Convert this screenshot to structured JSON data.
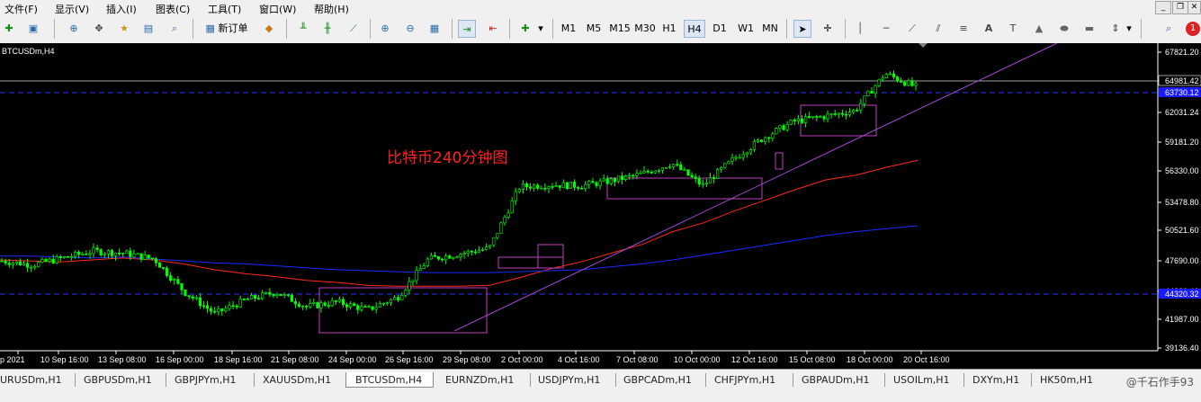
{
  "menu": {
    "items": [
      "文件(F)",
      "显示(V)",
      "插入(I)",
      "图表(C)",
      "工具(T)",
      "窗口(W)",
      "帮助(H)"
    ],
    "notification_count": "1"
  },
  "toolbar": {
    "new_order_label": "新订单",
    "timeframes": [
      "M1",
      "M5",
      "M15",
      "M30",
      "H1",
      "H4",
      "D1",
      "W1",
      "MN"
    ],
    "active_timeframe": "H4"
  },
  "chart": {
    "symbol_label": "BTCUSDm,H4",
    "annotation": "比特币240分钟图",
    "current_price_label": "64981.42",
    "blue_line_label_top": "63730.12",
    "blue_line_label_bottom": "44320.32",
    "price_ticks": [
      "67821.20",
      "64981.42",
      "62031.24",
      "59181.20",
      "56330.00",
      "53478.80",
      "50521.60",
      "47690.00",
      "44820.40",
      "41987.00",
      "39136.40"
    ],
    "time_ticks": [
      "p 2021",
      "10 Sep 16:00",
      "13 Sep 08:00",
      "16 Sep 00:00",
      "18 Sep 16:00",
      "21 Sep 08:00",
      "24 Sep 00:00",
      "26 Sep 16:00",
      "29 Sep 08:00",
      "2 Oct 00:00",
      "4 Oct 16:00",
      "7 Oct 08:00",
      "10 Oct 00:00",
      "12 Oct 16:00",
      "15 Oct 08:00",
      "18 Oct 00:00",
      "20 Oct 16:00"
    ],
    "colors": {
      "background": "#000000",
      "bull": "#00ff00",
      "bear": "#00ff00",
      "ma_red": "#ff2a1a",
      "ma_blue": "#1a2aff",
      "trendline": "#a04ad8",
      "boxes": "#c040c0",
      "annotation": "#ff2020"
    }
  },
  "chart_data": {
    "type": "line",
    "title": "BTCUSDm,H4",
    "ylim": [
      38000,
      69500
    ],
    "series": [
      {
        "values": [
          47200,
          46800,
          47500,
          48200,
          48000,
          47400,
          44000,
          41800,
          43200,
          44000,
          42500,
          43000,
          42200,
          43500,
          47400,
          47900,
          48500,
          54800,
          55000,
          54900,
          55400,
          56100,
          57200,
          54900,
          57600,
          59800,
          61500,
          62000,
          62600,
          66400,
          65000
        ]
      },
      {
        "values": [
          47300,
          47200,
          47100,
          47300,
          47500,
          47300,
          46900,
          46300,
          45900,
          45600,
          45200,
          45000,
          44700,
          44600,
          44600,
          44600,
          44700,
          45500,
          46400,
          47100,
          48000,
          48900,
          50200,
          51100,
          52300,
          53400,
          54500,
          55500,
          56000,
          56800,
          57500
        ]
      },
      {
        "values": [
          47700,
          47700,
          47600,
          47500,
          47600,
          47400,
          47200,
          47000,
          46900,
          46700,
          46500,
          46300,
          46200,
          46100,
          46000,
          46000,
          46000,
          46100,
          46200,
          46300,
          46600,
          46900,
          47300,
          47800,
          48300,
          48800,
          49300,
          49800,
          50200,
          50500,
          50800
        ]
      }
    ],
    "grid": false
  },
  "tabs": {
    "items": [
      "URUSDm,H1",
      "GBPUSDm,H1",
      "GBPJPYm,H1",
      "XAUUSDm,H1",
      "BTCUSDm,H4",
      "EURNZDm,H1",
      "USDJPYm,H1",
      "GBPCADm,H1",
      "CHFJPYm,H1",
      "GBPAUDm,H1",
      "USOILm,H1",
      "DXYm,H1",
      "HK50m,H1"
    ],
    "active": "BTCUSDm,H4",
    "watermark": "@千石作手93"
  }
}
